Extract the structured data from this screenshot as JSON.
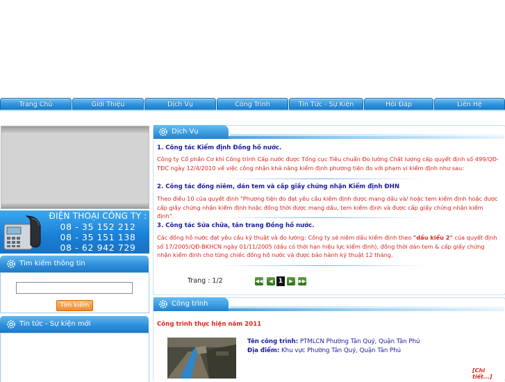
{
  "nav": {
    "items": [
      {
        "label": "Trang Chủ"
      },
      {
        "label": "Giới Thiệu"
      },
      {
        "label": "Dịch Vụ"
      },
      {
        "label": "Công Trình"
      },
      {
        "label": "Tin Tức - Sự Kiện"
      },
      {
        "label": "Hỏi Đáp"
      },
      {
        "label": "Liên Hệ"
      }
    ]
  },
  "contact": {
    "title": "ĐIỆN THOẠI CÔNG TY :",
    "phones": [
      "08 - 35 152 212",
      "08 - 35 151 138",
      "08 - 62 942 729"
    ]
  },
  "search": {
    "title": "Tìm kiếm thông tin",
    "input_value": "",
    "button_label": "Tìm kiếm"
  },
  "news": {
    "title": "Tin tức - Sự kiện mới"
  },
  "services": {
    "title": "Dịch Vụ",
    "items": [
      {
        "heading": "1. Công tác Kiểm định Đồng hồ nước.",
        "body": "Công ty Cổ phần Cơ khí Công trình Cấp nước được Tổng cục Tiêu chuẩn Đo lường Chất lượng cấp quyết định số 499/QĐ-TĐC ngày 12/4/2010 về việc công nhận khả năng kiểm định phương tiện đo với phạm vi kiểm định như sau:"
      },
      {
        "heading": "2. Công tác đóng niêm, dán tem và cấp giấy chứng nhận Kiểm định ĐHN",
        "body": "Theo điều 10 của quyết định \"Phương tiện đo đạt yêu cầu kiểm định được mang dấu và/ hoặc tem kiểm định hoặc được cấp giấy chứng nhận kiểm định hoặc đồng thời được mang dấu, tem kiểm định và được cấp giấy chứng nhận kiểm định\"."
      },
      {
        "heading": "3. Công tác Sửa chữa, tân trang Đồng hồ nước.",
        "body_pre": "Các đồng hồ nước đạt yêu cầu kỹ thuật và đo lường: Công ty sẽ niêm dấu kiểm định theo ",
        "body_bold": "\"dấu kiểu 2\"",
        "body_post": " của quyết định số 17/2005/QĐ-BKHCN ngày 01/11/2005 (dấu có thời hạn hiệu lực kiểm định), đồng thời dán tem & cấp giấy chứng nhận kiểm định cho từng chiếc đồng hồ nước và được bảo hành kỹ thuật 12 tháng."
      }
    ],
    "pager": {
      "label": "Trang : 1/2",
      "current": "1",
      "first_icon": "first-page-icon",
      "prev_icon": "prev-page-icon",
      "next_icon": "next-page-icon",
      "last_icon": "last-page-icon"
    }
  },
  "projects": {
    "title": "Công trình",
    "heading": "Công trình thực hiện năm 2011",
    "name_label": "Tên công trình:",
    "name_value": "PTMLCN Phường Tân Quý, Quận Tân Phú",
    "place_label": "Địa điểm:",
    "place_value": "Khu vực Phường Tân Quý, Quận Tân Phú",
    "more_label": "[Chi tiết...]"
  },
  "colors": {
    "nav_blue": "#2f93dc",
    "heading_blue": "#1a1aa0",
    "text_red": "#d9261c",
    "search_button": "#f08a2c"
  }
}
